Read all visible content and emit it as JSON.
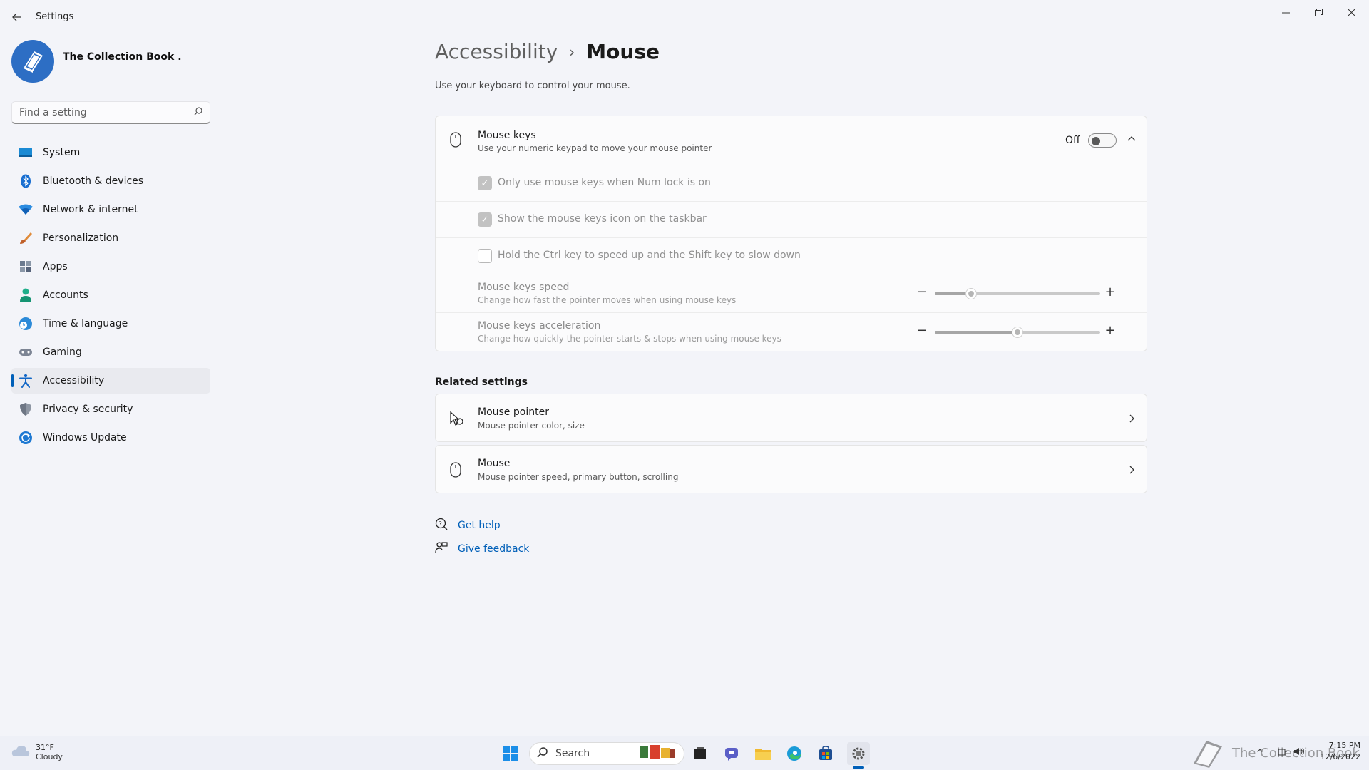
{
  "window": {
    "title": "Settings",
    "minimize": "—",
    "restore": "❐",
    "close": "✕"
  },
  "profile": {
    "name": "The Collection Book ."
  },
  "search": {
    "placeholder": "Find a setting"
  },
  "sidebar": {
    "items": [
      {
        "label": "System",
        "icon": "system-icon",
        "active": false
      },
      {
        "label": "Bluetooth & devices",
        "icon": "bluetooth-icon",
        "active": false
      },
      {
        "label": "Network & internet",
        "icon": "wifi-icon",
        "active": false
      },
      {
        "label": "Personalization",
        "icon": "brush-icon",
        "active": false
      },
      {
        "label": "Apps",
        "icon": "apps-icon",
        "active": false
      },
      {
        "label": "Accounts",
        "icon": "person-icon",
        "active": false
      },
      {
        "label": "Time & language",
        "icon": "clock-globe-icon",
        "active": false
      },
      {
        "label": "Gaming",
        "icon": "gamepad-icon",
        "active": false
      },
      {
        "label": "Accessibility",
        "icon": "accessibility-icon",
        "active": true
      },
      {
        "label": "Privacy & security",
        "icon": "shield-icon",
        "active": false
      },
      {
        "label": "Windows Update",
        "icon": "update-icon",
        "active": false
      }
    ]
  },
  "header": {
    "parent": "Accessibility",
    "separator": "›",
    "current": "Mouse",
    "description": "Use your keyboard to control your mouse."
  },
  "mouse_keys": {
    "title": "Mouse keys",
    "subtitle": "Use your numeric keypad to move your mouse pointer",
    "state_label": "Off",
    "enabled": false,
    "options": [
      {
        "label": "Only use mouse keys when Num lock is on",
        "checked": true
      },
      {
        "label": "Show the mouse keys icon on the taskbar",
        "checked": true
      },
      {
        "label": "Hold the Ctrl key to speed up and the Shift key to slow down",
        "checked": false
      }
    ],
    "speed": {
      "title": "Mouse keys speed",
      "subtitle": "Change how fast the pointer moves when using mouse keys",
      "value_fraction": 0.22,
      "minus": "−",
      "plus": "+"
    },
    "acceleration": {
      "title": "Mouse keys acceleration",
      "subtitle": "Change how quickly the pointer starts & stops when using mouse keys",
      "value_fraction": 0.5,
      "minus": "−",
      "plus": "+"
    }
  },
  "related": {
    "title": "Related settings",
    "items": [
      {
        "title": "Mouse pointer",
        "subtitle": "Mouse pointer color, size",
        "icon": "mouse-pointer-icon"
      },
      {
        "title": "Mouse",
        "subtitle": "Mouse pointer speed, primary button, scrolling",
        "icon": "mouse-icon"
      }
    ]
  },
  "help": {
    "get_help": "Get help",
    "give_feedback": "Give feedback"
  },
  "taskbar": {
    "weather_temp": "31°F",
    "weather_desc": "Cloudy",
    "search_label": "Search",
    "time": "7:15 PM",
    "date": "12/6/2022",
    "watermark": "The Collection Book"
  },
  "colors": {
    "accent": "#005fb8",
    "background": "#f3f4f9",
    "card": "#fbfbfc"
  }
}
